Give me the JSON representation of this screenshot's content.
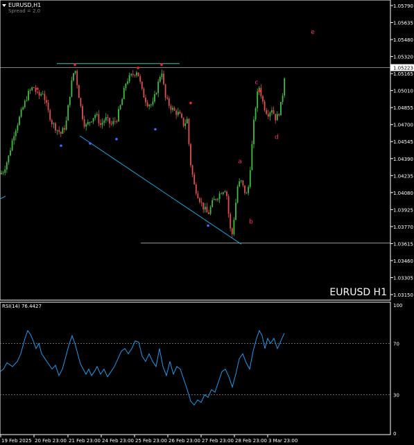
{
  "header": {
    "symbol_tf": "EURUSD,H1",
    "spread": "Spread = 2.0",
    "menu_icon": "triangle-down-icon"
  },
  "watermark": "EURUSD H1",
  "rsi_label": "RSI(14) 76.4427",
  "colors": {
    "background": "#000000",
    "grid_border": "#ffffff",
    "bull_candle": "#3fbf3f",
    "bear_candle": "#e05050",
    "trendline": "#1aa3d9",
    "hline": "#3fbfbf",
    "wave_label": "#ff2d8a",
    "rsi_line": "#1e9bf0",
    "swing_high_marker": "#ff2020",
    "swing_low_marker": "#3a6bff"
  },
  "chart_data": [
    {
      "type": "candlestick",
      "title": "EURUSD,H1",
      "ylim": [
        1.0315,
        1.0579
      ],
      "price_ticks": [
        "1.05790",
        "1.05635",
        "1.05480",
        "1.05320",
        "1.05165",
        "1.05010",
        "1.04855",
        "1.04700",
        "1.04545",
        "1.04390",
        "1.04235",
        "1.04080",
        "1.03925",
        "1.03770",
        "1.03615",
        "1.03460",
        "1.03305",
        "1.03150"
      ],
      "current_price": "1.05223",
      "time_ticks": [
        "19 Feb 2025",
        "20 Feb 23:00",
        "21 Feb 23:00",
        "24 Feb 23:00",
        "25 Feb 23:00",
        "26 Feb 23:00",
        "27 Feb 23:00",
        "28 Feb 23:00",
        "3 Mar 23:00"
      ],
      "close_path": [
        [
          0,
          1.0425
        ],
        [
          5,
          1.0428
        ],
        [
          12,
          1.044
        ],
        [
          20,
          1.0462
        ],
        [
          30,
          1.048
        ],
        [
          40,
          1.0498
        ],
        [
          48,
          1.0505
        ],
        [
          55,
          1.0496
        ],
        [
          62,
          1.05
        ],
        [
          68,
          1.0485
        ],
        [
          75,
          1.0472
        ],
        [
          82,
          1.0466
        ],
        [
          88,
          1.0462
        ],
        [
          95,
          1.047
        ],
        [
          100,
          1.0495
        ],
        [
          105,
          1.0515
        ],
        [
          108,
          1.0522
        ],
        [
          113,
          1.05
        ],
        [
          118,
          1.048
        ],
        [
          123,
          1.0468
        ],
        [
          130,
          1.0474
        ],
        [
          138,
          1.048
        ],
        [
          145,
          1.047
        ],
        [
          152,
          1.0476
        ],
        [
          160,
          1.047
        ],
        [
          168,
          1.0475
        ],
        [
          175,
          1.049
        ],
        [
          182,
          1.051
        ],
        [
          190,
          1.0515
        ],
        [
          198,
          1.052
        ],
        [
          205,
          1.05
        ],
        [
          212,
          1.049
        ],
        [
          220,
          1.0488
        ],
        [
          227,
          1.0505
        ],
        [
          233,
          1.0521
        ],
        [
          238,
          1.0495
        ],
        [
          245,
          1.0487
        ],
        [
          252,
          1.0482
        ],
        [
          258,
          1.048
        ],
        [
          265,
          1.047
        ],
        [
          270,
          1.0475
        ],
        [
          274,
          1.0438
        ],
        [
          280,
          1.0415
        ],
        [
          286,
          1.0405
        ],
        [
          292,
          1.0396
        ],
        [
          300,
          1.0388
        ],
        [
          307,
          1.04
        ],
        [
          314,
          1.0405
        ],
        [
          320,
          1.041
        ],
        [
          326,
          1.0412
        ],
        [
          331,
          1.038
        ],
        [
          334,
          1.0366
        ],
        [
          338,
          1.0388
        ],
        [
          343,
          1.0416
        ],
        [
          348,
          1.0418
        ],
        [
          352,
          1.041
        ],
        [
          357,
          1.0405
        ],
        [
          362,
          1.044
        ],
        [
          366,
          1.0472
        ],
        [
          370,
          1.0495
        ],
        [
          374,
          1.0505
        ],
        [
          380,
          1.0488
        ],
        [
          386,
          1.048
        ],
        [
          392,
          1.0485
        ],
        [
          398,
          1.0475
        ],
        [
          404,
          1.0484
        ],
        [
          408,
          1.05
        ],
        [
          411,
          1.052
        ]
      ],
      "horizontal_lines": [
        1.05223,
        1.0362
      ],
      "resistance_line": {
        "x1": 82,
        "x2": 259,
        "price": 1.0526
      },
      "trendline": {
        "x1": 115,
        "p1": 1.046,
        "x2": 348,
        "p2": 1.0361
      },
      "swing_highs": [
        [
          54,
          1.0503
        ],
        [
          108,
          1.0525
        ],
        [
          199,
          1.0522
        ],
        [
          233,
          1.0525
        ],
        [
          275,
          1.049
        ],
        [
          374,
          1.0501
        ]
      ],
      "swing_lows": [
        [
          88,
          1.0451
        ],
        [
          130,
          1.0453
        ],
        [
          168,
          1.0457
        ],
        [
          224,
          1.0466
        ],
        [
          300,
          1.0378
        ]
      ],
      "wave_labels": [
        {
          "text": "a",
          "x": 346,
          "price": 1.0435
        },
        {
          "text": "b",
          "x": 362,
          "price": 1.038
        },
        {
          "text": "c",
          "x": 370,
          "price": 1.0507
        },
        {
          "text": "d",
          "x": 399,
          "price": 1.0457
        },
        {
          "text": "e",
          "x": 451,
          "price": 1.0553
        }
      ]
    },
    {
      "type": "line",
      "title": "RSI(14) 76.4427",
      "ylim": [
        0,
        100
      ],
      "levels": [
        "100",
        "70",
        "30",
        "0"
      ],
      "hlines": [
        70,
        30
      ],
      "x": [
        0,
        5,
        10,
        18,
        25,
        30,
        36,
        40,
        44,
        48,
        52,
        56,
        60,
        65,
        70,
        75,
        80,
        85,
        90,
        95,
        100,
        104,
        108,
        112,
        116,
        120,
        124,
        128,
        132,
        136,
        140,
        145,
        150,
        155,
        160,
        165,
        170,
        175,
        180,
        185,
        190,
        195,
        200,
        205,
        210,
        215,
        220,
        225,
        230,
        235,
        240,
        245,
        250,
        255,
        260,
        265,
        270,
        275,
        280,
        285,
        290,
        295,
        300,
        305,
        310,
        315,
        320,
        325,
        330,
        335,
        340,
        345,
        350,
        355,
        360,
        365,
        370,
        374,
        378,
        382,
        386,
        390,
        395,
        400,
        405,
        410
      ],
      "values": [
        48,
        50,
        55,
        52,
        56,
        62,
        74,
        80,
        77,
        72,
        66,
        70,
        62,
        58,
        54,
        50,
        53,
        45,
        50,
        60,
        70,
        76,
        70,
        62,
        54,
        50,
        46,
        50,
        45,
        48,
        52,
        46,
        50,
        44,
        48,
        52,
        58,
        64,
        66,
        62,
        66,
        72,
        71,
        60,
        56,
        62,
        56,
        52,
        66,
        52,
        45,
        56,
        46,
        52,
        50,
        42,
        34,
        25,
        22,
        26,
        24,
        30,
        28,
        34,
        32,
        40,
        48,
        50,
        44,
        36,
        46,
        58,
        62,
        55,
        50,
        64,
        74,
        80,
        76,
        66,
        74,
        70,
        74,
        66,
        72,
        78
      ]
    }
  ]
}
